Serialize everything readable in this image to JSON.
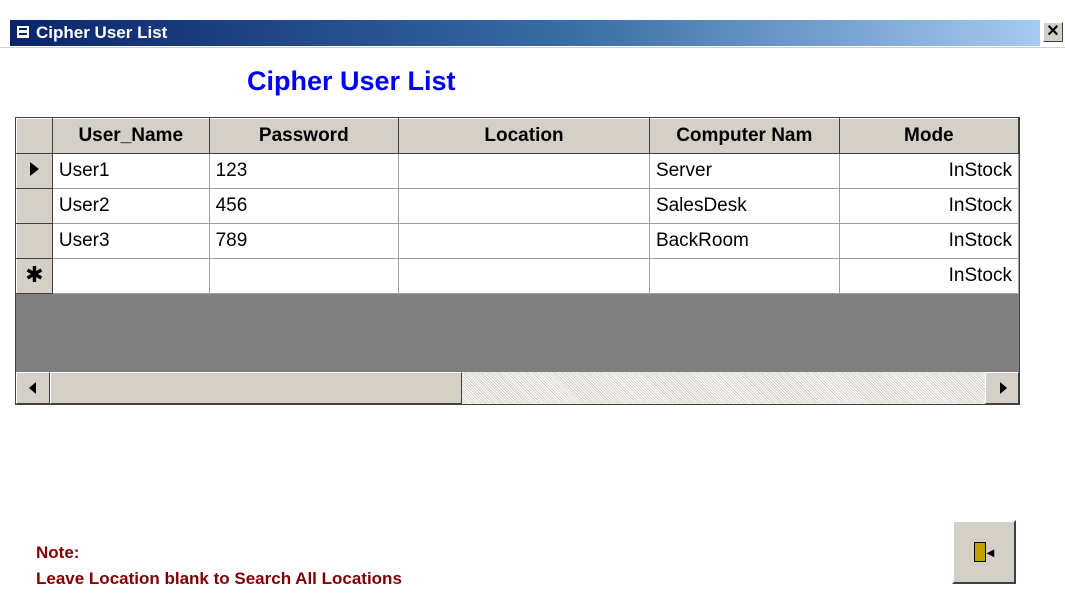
{
  "window": {
    "title": "Cipher User List",
    "close_glyph": "✕"
  },
  "form": {
    "heading": "Cipher User List"
  },
  "grid": {
    "columns": [
      "User_Name",
      "Password",
      "Location",
      "Computer Nam",
      "Mode"
    ],
    "rows": [
      {
        "user_name": "User1",
        "password": "123",
        "location": "",
        "computer_name": "Server",
        "mode": "InStock",
        "current": true
      },
      {
        "user_name": "User2",
        "password": "456",
        "location": "",
        "computer_name": "SalesDesk",
        "mode": "InStock",
        "current": false
      },
      {
        "user_name": "User3",
        "password": "789",
        "location": "",
        "computer_name": "BackRoom",
        "mode": "InStock",
        "current": false
      }
    ],
    "new_row": {
      "mode": "InStock",
      "marker": "✱"
    }
  },
  "note": {
    "label": "Note:",
    "text": "Leave Location blank to Search All Locations"
  },
  "exit_button": {
    "icon": "exit-door-icon",
    "arrow_glyph": "◂"
  },
  "colors": {
    "heading": "#0000ff",
    "note": "#800000",
    "titlebar_start": "#0a246a",
    "titlebar_end": "#a6caf0"
  }
}
